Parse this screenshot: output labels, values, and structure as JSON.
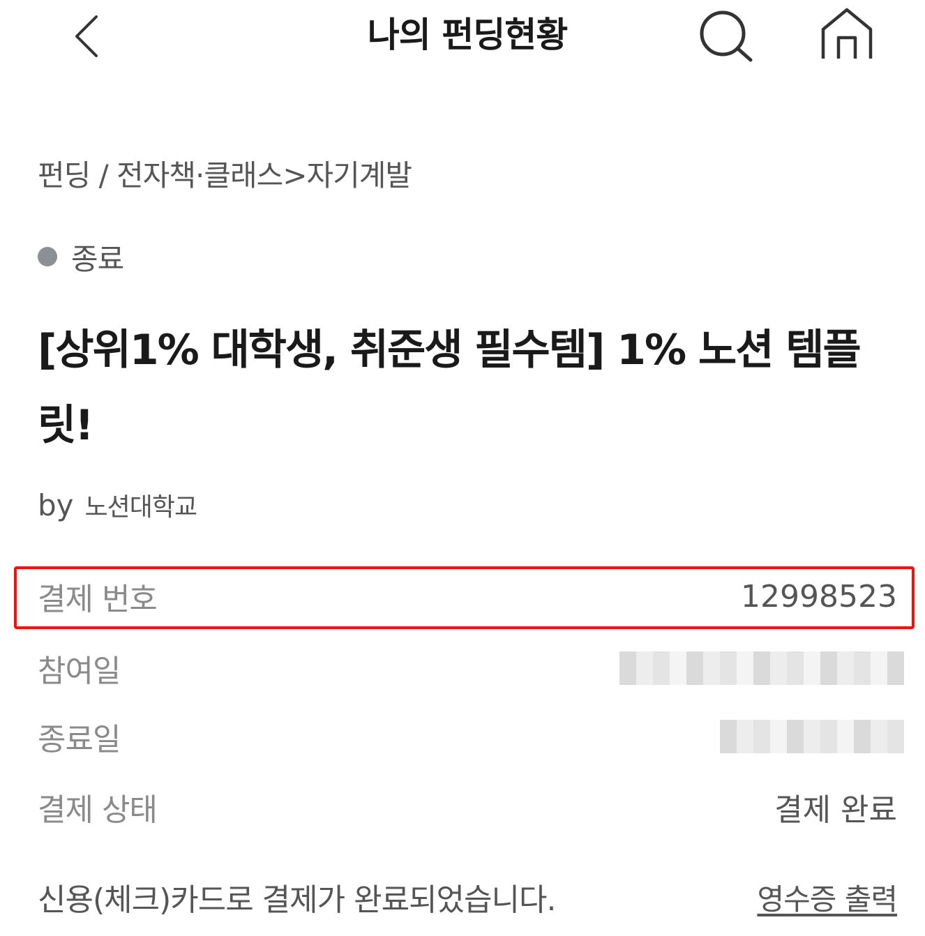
{
  "header": {
    "title": "나의 펀딩현황",
    "back_icon": "chevron-left-icon",
    "search_icon": "search-icon",
    "home_icon": "home-icon"
  },
  "breadcrumb": "펀딩 / 전자책·클래스>자기계발",
  "status": {
    "label": "종료",
    "dot_color": "#8d8f94"
  },
  "project": {
    "title": "[상위1% 대학생, 취준생 필수템] 1% 노션 템플릿!",
    "by_label": "by",
    "author": "노션대학교"
  },
  "details": {
    "payment_number_label": "결제 번호",
    "payment_number_value": "12998523",
    "join_date_label": "참여일",
    "end_date_label": "종료일",
    "payment_status_label": "결제 상태",
    "payment_status_value": "결제 완료"
  },
  "footer": {
    "message": "신용(체크)카드로 결제가 완료되었습니다.",
    "receipt_link": "영수증 출력"
  },
  "colors": {
    "highlight": "#ee1111",
    "text_primary": "#1a1a1a",
    "text_secondary": "#555555",
    "text_label": "#8a8a8a"
  }
}
